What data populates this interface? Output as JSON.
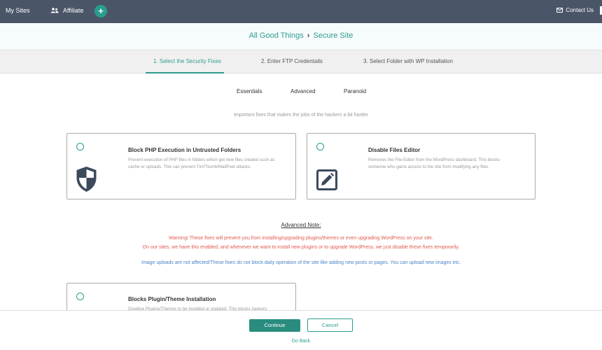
{
  "topbar": {
    "my_sites": "My Sites",
    "affiliate": "Affiliate",
    "add": "+",
    "contact": "Contact Us"
  },
  "header": {
    "site": "All Good Things",
    "separator": "›",
    "page": "Secure Site"
  },
  "steps": [
    {
      "label": "1. Select the Security Fixes",
      "active": true
    },
    {
      "label": "2. Enter FTP Credentails",
      "active": false
    },
    {
      "label": "3. Select Folder with WP Installation",
      "active": false
    }
  ],
  "subtabs": [
    "Essentials",
    "Advanced",
    "Paranoid"
  ],
  "subtitle": "Important fixes that makes the jobs of the hackers a bit harder",
  "cards": [
    {
      "title": "Block PHP Execution in Untrusted Folders",
      "desc_lines": [
        "Prevent execution of PHP files in folders which get new files created such as",
        "cache or uploads. This can prevent TimThumb/MailPoet attacks."
      ],
      "icon": "shield-icon"
    },
    {
      "title": "Disable Files Editor",
      "desc_lines": [
        "Removes the File-Editor from the WordPress dashboard. This blocks",
        "someone who gains access to the site from modifying any files."
      ],
      "icon": "edit-icon"
    },
    {
      "title": "Blocks Plugin/Theme Installation",
      "desc_lines": [
        "Disallow Plugins/Themes to be installed or updated. This blocks hackers"
      ],
      "icon": "none"
    }
  ],
  "note": {
    "heading": "Advanced Note:",
    "warning_1": "Warning! These fixes will prevent you from installing/upgrading plugins/themes or even upgrading WordPress on your site.",
    "warning_2": "On our sites, we have this enabled, and whenever we want to install new plugins or to upgrade WordPress, we just disable these fixes temporarily.",
    "info": "Image uploads are not affected!These fixes do not block daily operation of the site like adding new posts or pages. You can upload new images etc."
  },
  "footer": {
    "continue": "Continue",
    "cancel": "Cancel",
    "go_back": "Go Back"
  },
  "colors": {
    "topbar": "#4a5668",
    "accent": "#2a9d8f",
    "warning": "#e05a4f",
    "info": "#4a84c6"
  }
}
